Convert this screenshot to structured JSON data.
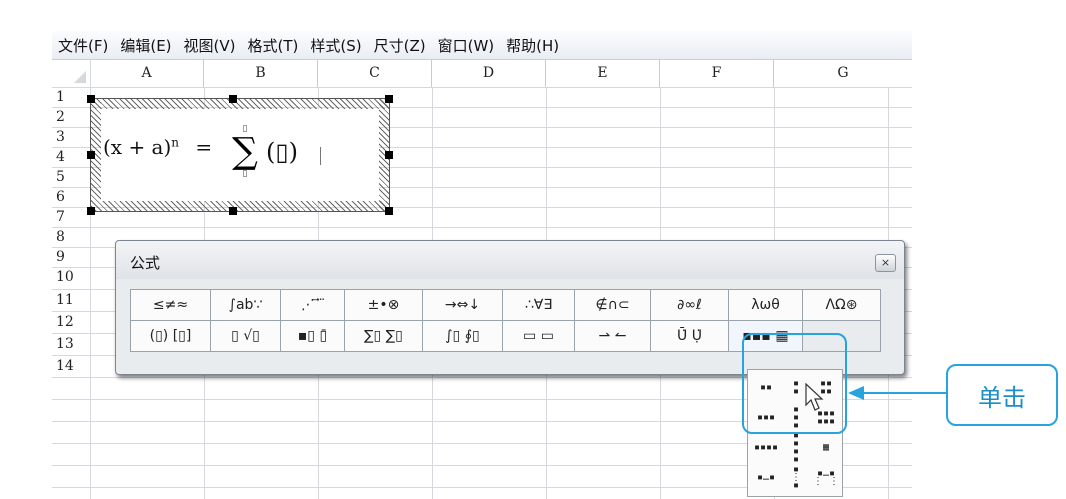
{
  "menu": [
    {
      "label": "文件(F)"
    },
    {
      "label": "编辑(E)"
    },
    {
      "label": "视图(V)"
    },
    {
      "label": "格式(T)"
    },
    {
      "label": "样式(S)"
    },
    {
      "label": "尺寸(Z)"
    },
    {
      "label": "窗口(W)"
    },
    {
      "label": "帮助(H)"
    }
  ],
  "columns": [
    "A",
    "B",
    "C",
    "D",
    "E",
    "F",
    "G"
  ],
  "rows": [
    "1",
    "2",
    "3",
    "4",
    "5",
    "6",
    "7",
    "8",
    "9",
    "10",
    "11",
    "12",
    "13",
    "14"
  ],
  "equation": {
    "lhs": "(x + a)",
    "exponent": "n",
    "equals": "=",
    "sigma": "∑",
    "upper": "▯",
    "lower": "▯",
    "term": "(▯)"
  },
  "palette": {
    "title": "公式",
    "close": "×",
    "row1": [
      "≤≠≈",
      "∫ab∵",
      "⋰ ⃗ ⃛",
      "±•⊗",
      "→⇔↓",
      "∴∀∃",
      "∉∩⊂",
      "∂∞ℓ",
      "λωθ",
      "ΛΩ⊛"
    ],
    "row2": [
      "(▯) [▯]",
      "▯ √▯",
      "▪▯ ▯̄",
      "∑▯ ∑▯",
      "∫▯ ∮▯",
      "▭ ▭",
      "⇀ ↼",
      "Ū̇ Ụ̇",
      "▪▪▪ ▦",
      ""
    ]
  },
  "dropdown": {
    "items": [
      "▪▪",
      "▪\n▪",
      "▪▪\n▪▪",
      "▪▪▪",
      "▪\n▪\n▪",
      "▪▪▪\n▪▪▪",
      "▪▪▪▪",
      "▪\n▪\n▪\n▪",
      "▦",
      "▪…▪",
      "▪\n⋮\n▪",
      "▪…▪\n⋮ ⋮"
    ]
  },
  "callout": {
    "label": "单击"
  },
  "colors": {
    "accent": "#27a3dd",
    "callout_text": "#1b8ec5"
  }
}
